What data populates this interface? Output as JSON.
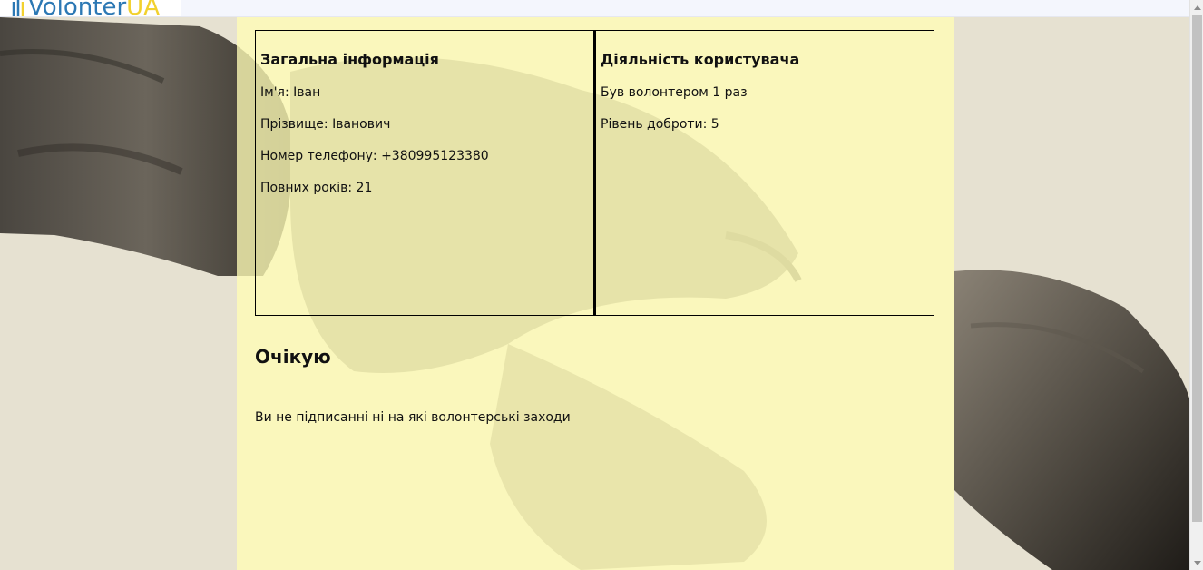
{
  "header": {
    "logo_text_main": "Volonter",
    "logo_text_accent": "UA",
    "logo_colors": {
      "blue": "#2c78b4",
      "yellow": "#f2d12e"
    }
  },
  "profile": {
    "general": {
      "title": "Загальна інформація",
      "first_name": "Ім'я: Іван",
      "last_name": "Прізвище: Іванович",
      "phone": "Номер телефону: +380995123380",
      "age": "Повних років: 21"
    },
    "activity": {
      "title": "Діяльність користувача",
      "volunteer_count": "Був волонтером 1 раз",
      "kindness_level": "Рівень доброти: 5"
    }
  },
  "pending": {
    "title": "Очікую",
    "empty_message": "Ви не підписанні ні на які волонтерські заходи"
  },
  "theme": {
    "panel_color": "#fffdb6",
    "background_color": "#e6e1d1"
  }
}
